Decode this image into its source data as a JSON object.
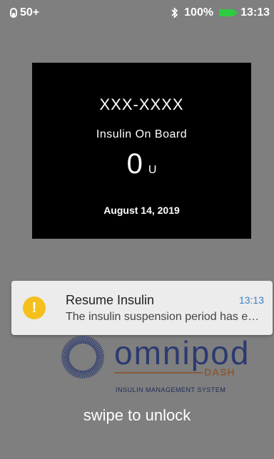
{
  "status_bar": {
    "signal_text": "50+",
    "battery_text": "100%",
    "time": "13:13"
  },
  "card": {
    "serial": "XXX-XXXX",
    "iob_label": "Insulin On Board",
    "iob_value": "0",
    "iob_unit": "U",
    "date": "August 14, 2019"
  },
  "notification": {
    "title": "Resume Insulin",
    "time": "13:13",
    "text": "The insulin suspension period has ended."
  },
  "logo": {
    "word": "omnipod",
    "dash": "DASH",
    "subtitle": "INSULIN MANAGEMENT SYSTEM"
  },
  "lock": {
    "hint": "swipe to unlock"
  },
  "colors": {
    "background": "#7f7f7f",
    "battery": "#2ecc40",
    "notification_icon": "#f5c01e",
    "notification_time": "#3b82c4"
  }
}
